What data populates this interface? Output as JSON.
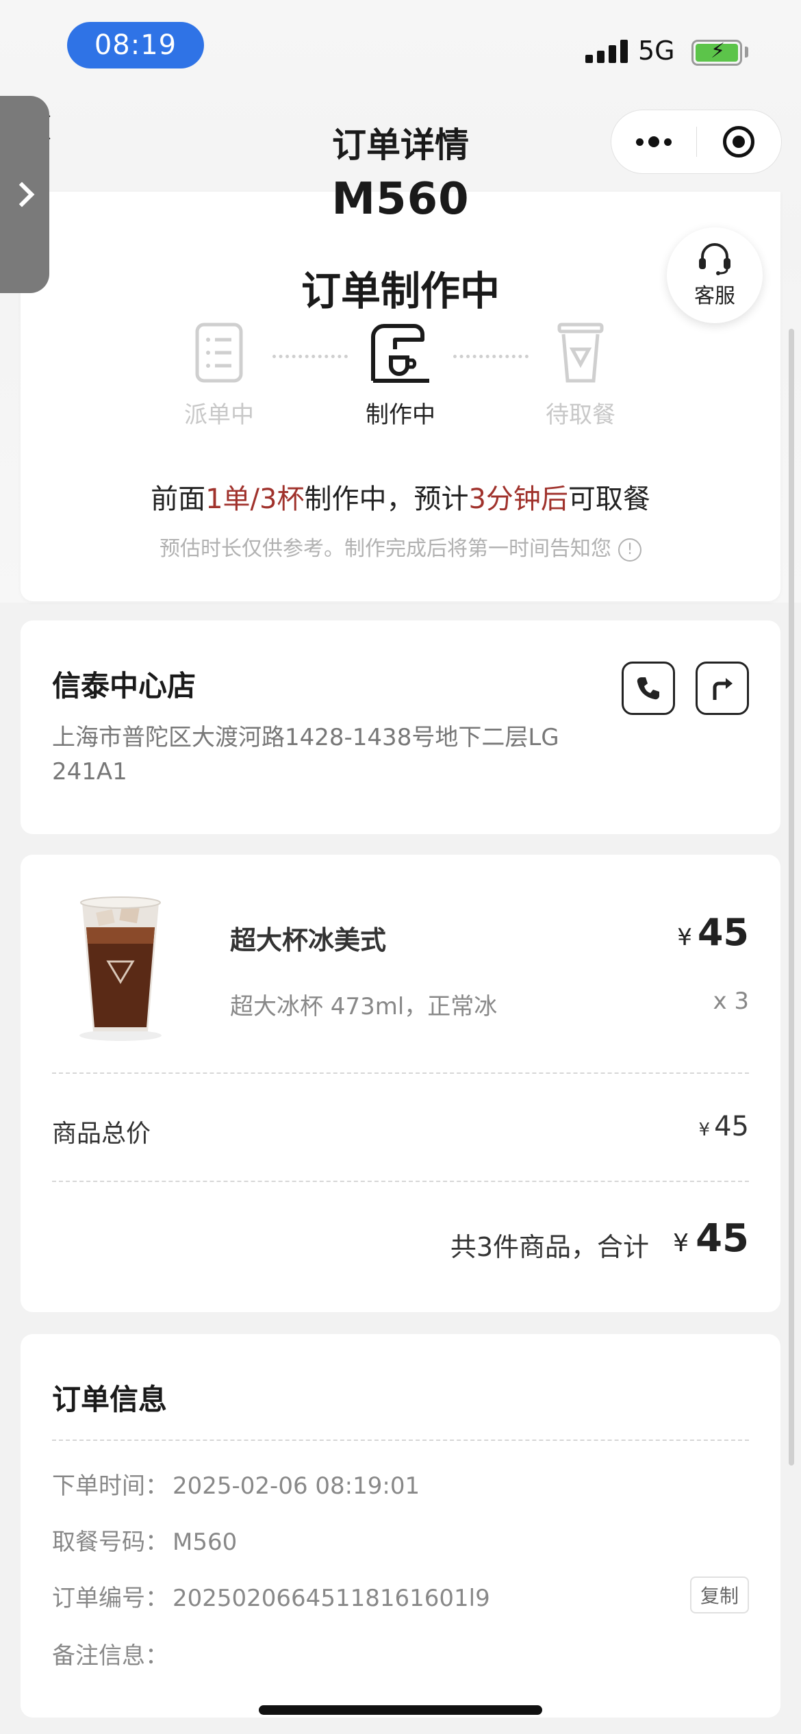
{
  "status_bar": {
    "time": "08:19",
    "network": "5G"
  },
  "nav": {
    "title": "订单详情"
  },
  "side_tab": {
    "icon": "chevron-right-icon"
  },
  "order": {
    "pickup_number": "M560",
    "status_title": "订单制作中",
    "customer_service_label": "客服",
    "steps": [
      {
        "label": "派单中",
        "icon": "document-list-icon",
        "active": false
      },
      {
        "label": "制作中",
        "icon": "coffee-machine-icon",
        "active": true
      },
      {
        "label": "待取餐",
        "icon": "cup-icon",
        "active": false
      }
    ],
    "eta": {
      "prefix": "前面",
      "queue": "1单/3杯",
      "middle": "制作中，预计",
      "time": "3分钟后",
      "suffix": "可取餐"
    },
    "eta_note": "预估时长仅供参考。制作完成后将第一时间告知您"
  },
  "store": {
    "name": "信泰中心店",
    "address": "上海市普陀区大渡河路1428-1438号地下二层LG 241A1"
  },
  "items": [
    {
      "name": "超大杯冰美式",
      "currency": "¥",
      "price": "45",
      "spec": "超大冰杯 473ml，正常冰",
      "qty": "x 3"
    }
  ],
  "summary": {
    "subtotal_label": "商品总价",
    "currency": "¥",
    "subtotal": "45",
    "total_label": "共3件商品，合计",
    "total": "45"
  },
  "order_info": {
    "title": "订单信息",
    "order_time_label": "下单时间：",
    "order_time": "2025-02-06 08:19:01",
    "pickup_code_label": "取餐号码：",
    "pickup_code": "M560",
    "order_id_label": "订单编号：",
    "order_id": "20250206645118161601l9",
    "copy_label": "复制",
    "remark_label": "备注信息：",
    "remark": ""
  },
  "colors": {
    "accent_red": "#a0322c",
    "time_pill": "#2f73e6",
    "battery": "#5cc44a"
  }
}
